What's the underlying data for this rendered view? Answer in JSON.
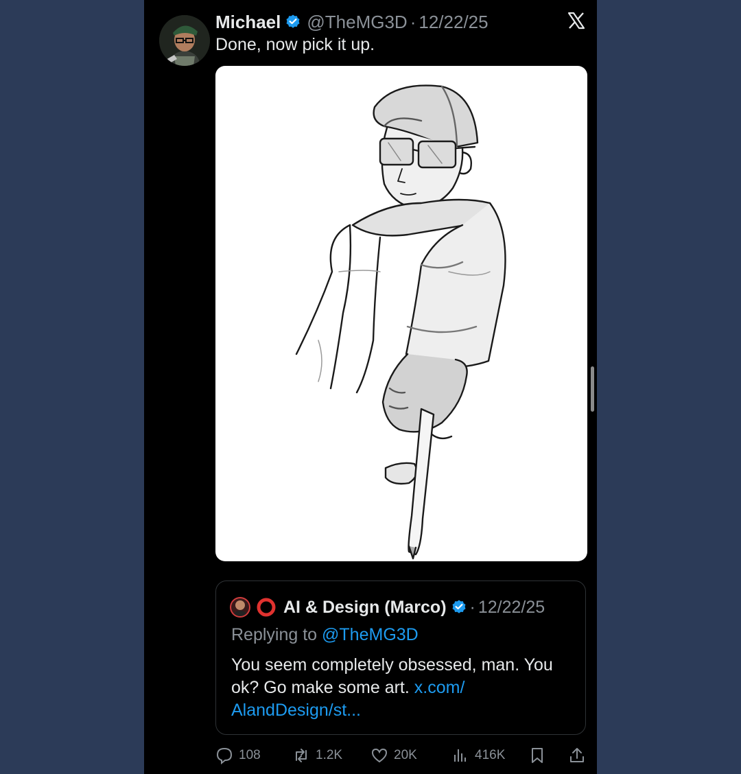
{
  "colors": {
    "page_background": "#2c3b58",
    "panel_background": "#000000",
    "primary_text": "#e7e9ea",
    "secondary_text": "#8b9198",
    "link": "#1d9bf0",
    "verified_badge": "#1d9bf0"
  },
  "tweet": {
    "author_name": "Michael",
    "handle": "@TheMG3D",
    "separator": "·",
    "date": "12/22/25",
    "text": "Done, now pick it up.",
    "brand_icon": "x-logo-icon",
    "media_description_icon": "sketch-image"
  },
  "quoted_tweet": {
    "status_icon": "red-circle-icon",
    "author_name": "AI & Design (Marco)",
    "separator": "·",
    "date": "12/22/25",
    "replying_prefix": "Replying to",
    "replying_handle": "@TheMG3D",
    "body_text": "You seem completely obsessed, man. You ok? Go make some art.",
    "link_line1": "x.com/",
    "link_line2": "AlandDesign/st..."
  },
  "actions": {
    "replies": "108",
    "reposts": "1.2K",
    "likes": "20K",
    "views": "416K"
  }
}
